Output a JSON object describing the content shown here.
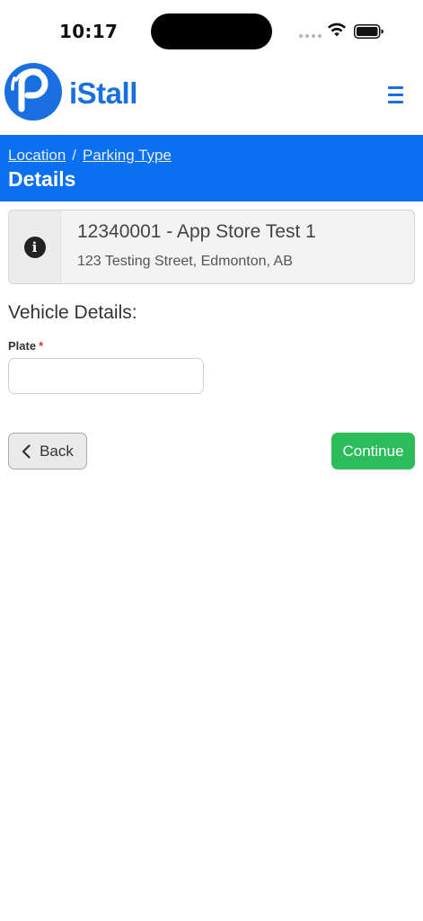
{
  "status_bar": {
    "time": "10:17"
  },
  "header": {
    "brand": "iStall",
    "brand_color": "#1a6fe0",
    "logo_icon": "parking-signal-logo",
    "menu_icon": "hamburger-menu-icon"
  },
  "breadcrumb": {
    "items": [
      {
        "label": "Location"
      },
      {
        "label": "Parking Type"
      }
    ],
    "separator": "/",
    "current": "Details",
    "band_color": "#0a6ff0"
  },
  "location_card": {
    "icon": "info-icon",
    "title": "12340001 - App Store Test 1",
    "address": "123 Testing Street, Edmonton, AB"
  },
  "form": {
    "heading": "Vehicle Details:",
    "plate_label": "Plate",
    "required_marker": "*",
    "plate_value": "",
    "plate_placeholder": ""
  },
  "actions": {
    "back_label": "Back",
    "continue_label": "Continue",
    "continue_color": "#2cbc5a"
  }
}
